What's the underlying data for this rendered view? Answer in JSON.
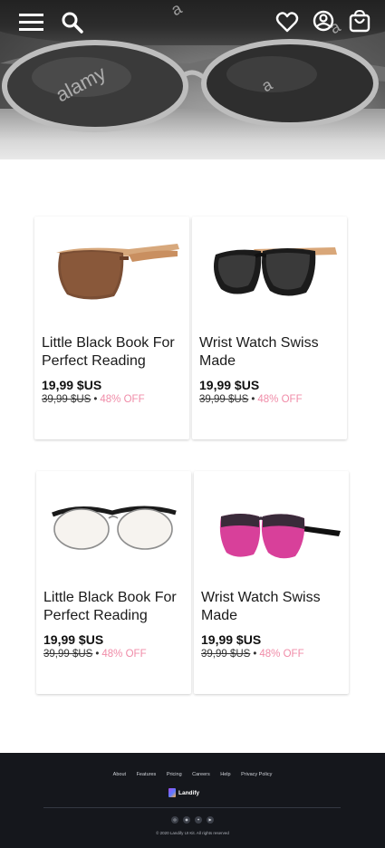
{
  "hero": {
    "watermarks": [
      "alamy",
      "a",
      "a",
      "a"
    ],
    "icons": [
      "menu-icon",
      "search-icon",
      "heart-icon",
      "user-icon",
      "cart-icon"
    ]
  },
  "products": [
    {
      "name": "Little Black Book For Perfect Reading",
      "price": "19,99 $US",
      "old_price": "39,99 $US",
      "separator": "•",
      "discount": "48% OFF",
      "image": "brown-wood-sunglasses"
    },
    {
      "name": "Wrist Watch Swiss Made",
      "price": "19,99 $US",
      "old_price": "39,99 $US",
      "separator": "•",
      "discount": "48% OFF",
      "image": "black-wood-sunglasses"
    },
    {
      "name": "Little Black Book For Perfect Reading",
      "price": "19,99 $US",
      "old_price": "39,99 $US",
      "separator": "•",
      "discount": "48% OFF",
      "image": "black-browline-eyeglasses"
    },
    {
      "name": "Wrist Watch Swiss Made",
      "price": "19,99 $US",
      "old_price": "39,99 $US",
      "separator": "•",
      "discount": "48% OFF",
      "image": "pink-tortoise-eyeglasses"
    }
  ],
  "footer": {
    "links": [
      "About",
      "Features",
      "Pricing",
      "Careers",
      "Help",
      "Privacy Policy"
    ],
    "logo_text": "Landify",
    "social": [
      "instagram-icon",
      "dribbble-icon",
      "twitter-icon",
      "youtube-icon"
    ],
    "copyright": "© 2020 Landify UI Kit. All rights reserved"
  },
  "colors": {
    "discount": "#f08ca8",
    "footer_bg": "#15171c",
    "text": "#111111"
  }
}
